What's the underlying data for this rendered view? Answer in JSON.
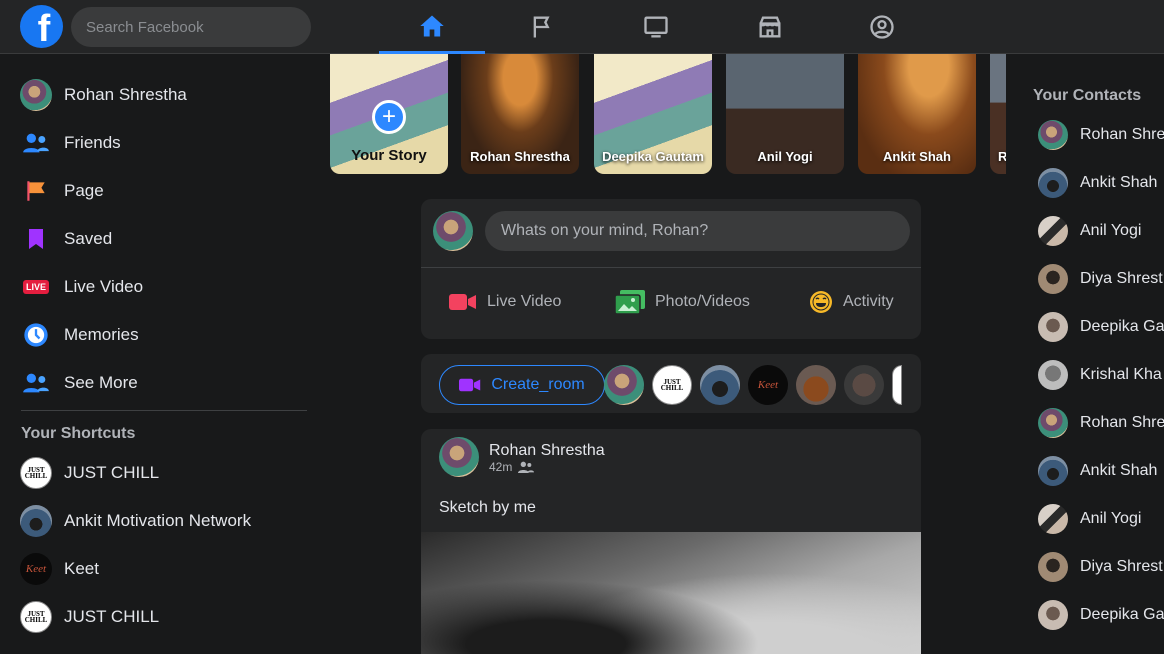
{
  "topbar": {
    "logo_letter": "f",
    "search_placeholder": "Search Facebook",
    "tabs": [
      {
        "name": "home",
        "icon": "home-icon",
        "active": true
      },
      {
        "name": "pages",
        "icon": "flag-icon",
        "active": false
      },
      {
        "name": "watch",
        "icon": "tv-icon",
        "active": false
      },
      {
        "name": "marketplace",
        "icon": "store-icon",
        "active": false
      },
      {
        "name": "profile",
        "icon": "user-circle-icon",
        "active": false
      }
    ]
  },
  "sidebar": {
    "items": [
      {
        "label": "Rohan Shrestha",
        "icon": "profile-avatar"
      },
      {
        "label": "Friends",
        "icon": "friends-icon"
      },
      {
        "label": "Page",
        "icon": "flag-icon"
      },
      {
        "label": "Saved",
        "icon": "bookmark-icon"
      },
      {
        "label": "Live Video",
        "icon": "live-icon",
        "badge": "LIVE"
      },
      {
        "label": "Memories",
        "icon": "clock-icon"
      },
      {
        "label": "See More",
        "icon": "people-icon"
      }
    ],
    "shortcuts_title": "Your Shortcuts",
    "shortcuts": [
      {
        "label": "JUST CHILL",
        "avatar_text": "JUST CHILL"
      },
      {
        "label": "Ankit Motivation Network"
      },
      {
        "label": "Keet",
        "avatar_text": "Keet"
      },
      {
        "label": "JUST CHILL",
        "avatar_text": "JUST CHILL"
      }
    ]
  },
  "stories": [
    {
      "name": "Your Story",
      "add": "+"
    },
    {
      "name": "Rohan Shrestha"
    },
    {
      "name": "Deepika Gautam"
    },
    {
      "name": "Anil Yogi"
    },
    {
      "name": "Ankit Shah"
    },
    {
      "name": "R"
    }
  ],
  "composer": {
    "placeholder": "Whats on your mind, Rohan?",
    "actions": [
      {
        "label": "Live Video",
        "icon": "video-camera-icon",
        "color": "#f3425f"
      },
      {
        "label": "Photo/Videos",
        "icon": "photo-icon",
        "color": "#45bd62"
      },
      {
        "label": "Activity",
        "icon": "smile-icon",
        "color": "#f7b928"
      }
    ]
  },
  "rooms": {
    "create_label": "Create_room",
    "avatar_text": {
      "chill": "JUST CHILL",
      "keet": "Keet"
    }
  },
  "post": {
    "author": "Rohan Shrestha",
    "time": "42m",
    "audience_icon": "friends-icon",
    "text": "Sketch by me"
  },
  "contacts": {
    "title": "Your Contacts",
    "items": [
      {
        "label": "Rohan Shre"
      },
      {
        "label": "Ankit Shah"
      },
      {
        "label": "Anil Yogi"
      },
      {
        "label": "Diya Shrest"
      },
      {
        "label": "Deepika Ga"
      },
      {
        "label": "Krishal Kha"
      },
      {
        "label": "Rohan Shre"
      },
      {
        "label": "Ankit Shah"
      },
      {
        "label": "Anil Yogi"
      },
      {
        "label": "Diya Shrest"
      },
      {
        "label": "Deepika Ga"
      }
    ]
  },
  "colors": {
    "accent": "#2d88ff",
    "background": "#18191a",
    "card": "#242526",
    "live_red": "#e41e3f"
  }
}
